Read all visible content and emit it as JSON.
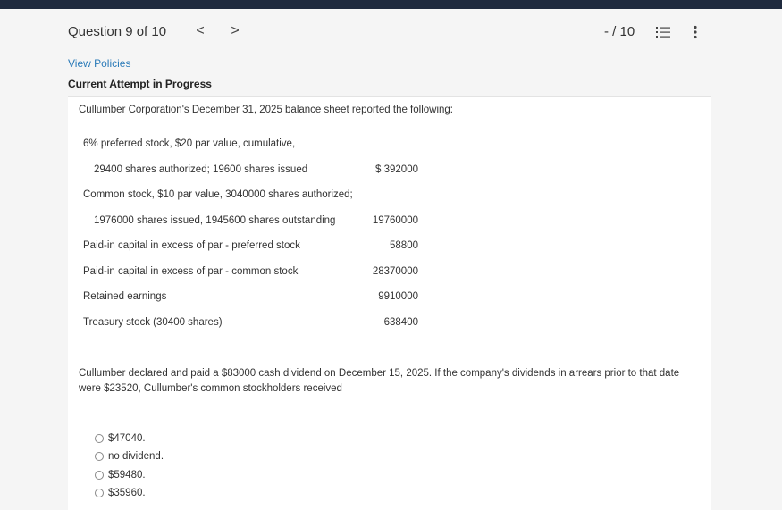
{
  "header": {
    "question_label": "Question 9 of 10",
    "prev_glyph": "<",
    "next_glyph": ">",
    "score": "- / 10"
  },
  "links": {
    "view_policies": "View Policies"
  },
  "attempt": {
    "status": "Current Attempt in Progress"
  },
  "problem": {
    "intro": "Cullumber Corporation's December 31, 2025 balance sheet reported the following:",
    "rows": [
      {
        "label": "6% preferred stock, $20 par value, cumulative,",
        "amount": ""
      },
      {
        "label": "29400 shares authorized; 19600 shares issued",
        "amount": "$ 392000"
      },
      {
        "label": "Common stock, $10 par value, 3040000 shares authorized;",
        "amount": ""
      },
      {
        "label": "1976000 shares issued, 1945600 shares outstanding",
        "amount": "19760000"
      },
      {
        "label": "Paid-in capital in excess of par - preferred stock",
        "amount": "58800"
      },
      {
        "label": "Paid-in capital in excess of par - common stock",
        "amount": "28370000"
      },
      {
        "label": "Retained earnings",
        "amount": "9910000"
      },
      {
        "label": "Treasury stock (30400 shares)",
        "amount": "638400"
      }
    ],
    "question": "Cullumber declared and paid a $83000 cash dividend on December 15, 2025. If the company's dividends in arrears prior to that date were $23520, Cullumber's common stockholders received"
  },
  "options": [
    {
      "label": "$47040."
    },
    {
      "label": "no dividend."
    },
    {
      "label": "$59480."
    },
    {
      "label": "$35960."
    }
  ],
  "icons": {
    "prev": "chevron-left-icon",
    "next": "chevron-right-icon",
    "list": "question-list-icon",
    "more": "more-vertical-icon"
  },
  "colors": {
    "topbar": "#1f2a3e",
    "link": "#2a7ab8",
    "page_background": "#f5f5f5",
    "panel_background": "#ffffff"
  }
}
